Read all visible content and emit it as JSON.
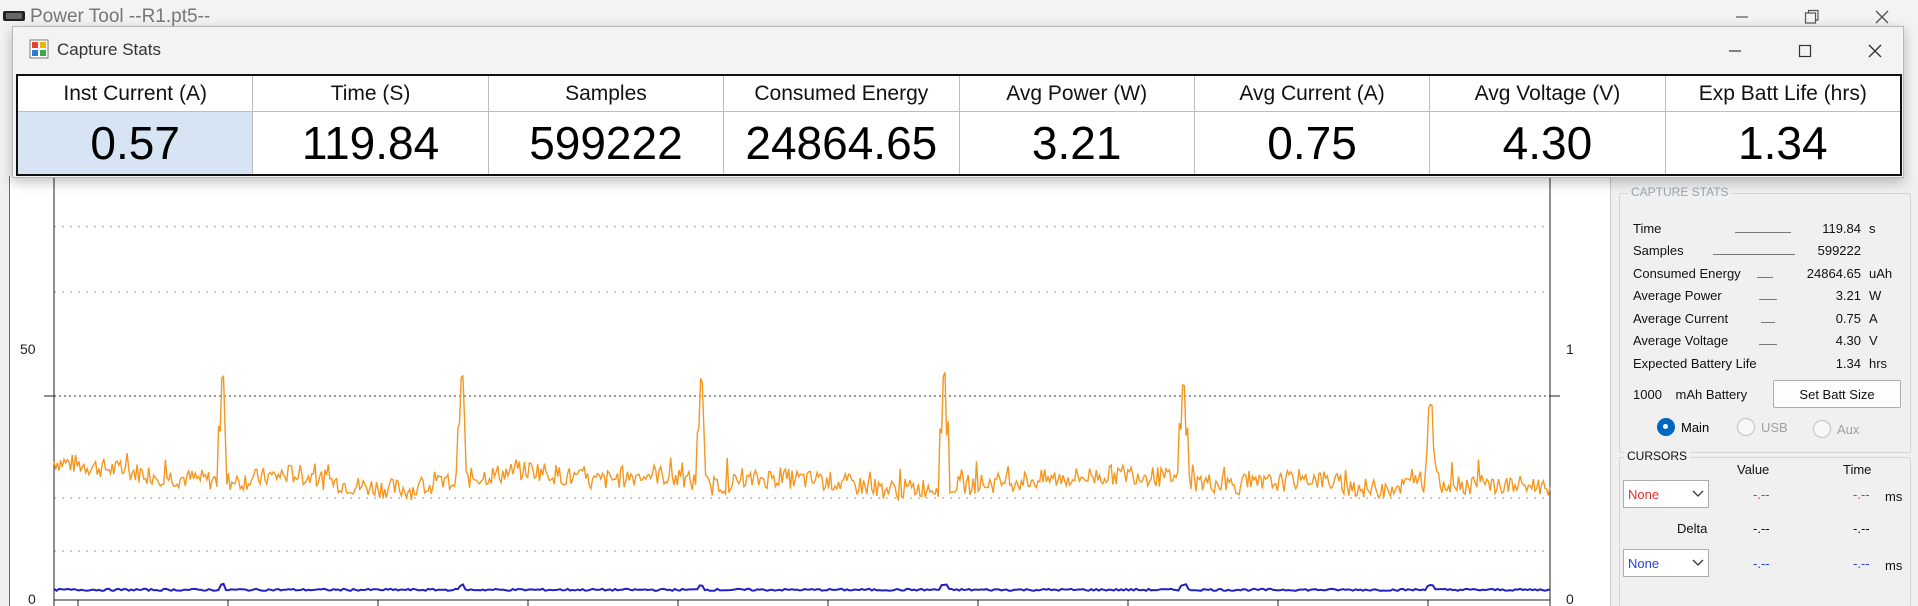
{
  "main_window": {
    "title": "Power Tool --R1.pt5--"
  },
  "capture_window": {
    "title": "Capture Stats",
    "columns": [
      {
        "header": "Inst Current (A)",
        "value": "0.57"
      },
      {
        "header": "Time (S)",
        "value": "119.84"
      },
      {
        "header": "Samples",
        "value": "599222"
      },
      {
        "header": "Consumed Energy",
        "value": "24864.65"
      },
      {
        "header": "Avg Power (W)",
        "value": "3.21"
      },
      {
        "header": "Avg Current (A)",
        "value": "0.75"
      },
      {
        "header": "Avg Voltage (V)",
        "value": "4.30"
      },
      {
        "header": "Exp Batt Life (hrs)",
        "value": "1.34"
      }
    ]
  },
  "chart_data": {
    "type": "line",
    "left_axis_ticks": [
      "50",
      "0"
    ],
    "right_axis_ticks": [
      "1",
      "0"
    ],
    "ylim": [
      0,
      100
    ],
    "series": [
      {
        "color": "#f5961e",
        "x": [
          0,
          8,
          16,
          24,
          32,
          40,
          48,
          56,
          64,
          72,
          80,
          88,
          96,
          104,
          112,
          120,
          128,
          136,
          144,
          152,
          160,
          168,
          176,
          184,
          192,
          200
        ],
        "values": [
          34,
          32,
          30,
          29,
          31,
          28,
          27,
          30,
          32,
          29,
          31,
          28,
          30,
          29,
          27,
          28,
          29,
          30,
          31,
          29,
          28,
          30,
          27,
          29,
          28,
          28
        ]
      },
      {
        "color": "#2020c8",
        "x": [
          0,
          50,
          100,
          150,
          200
        ],
        "values": [
          2.5,
          2.5,
          2.5,
          2.5,
          2.5
        ]
      }
    ],
    "orange_spikes": [
      {
        "x": 22.5,
        "y": 56
      },
      {
        "x": 54.5,
        "y": 56
      },
      {
        "x": 86.5,
        "y": 55
      },
      {
        "x": 119,
        "y": 56
      },
      {
        "x": 151,
        "y": 54
      },
      {
        "x": 184,
        "y": 48
      }
    ]
  },
  "right_panel": {
    "capture_stats": {
      "title": "CAPTURE STATS",
      "rows": [
        {
          "label": "Time",
          "value": "119.84",
          "unit": "s"
        },
        {
          "label": "Samples",
          "value": "599222",
          "unit": ""
        },
        {
          "label": "Consumed Energy",
          "value": "24864.65",
          "unit": "uAh"
        },
        {
          "label": "Average Power",
          "value": "3.21",
          "unit": "W"
        },
        {
          "label": "Average Current",
          "value": "0.75",
          "unit": "A"
        },
        {
          "label": "Average Voltage",
          "value": "4.30",
          "unit": "V"
        },
        {
          "label": "Expected Battery Life",
          "value": "1.34",
          "unit": "hrs"
        }
      ],
      "battery_size": "1000",
      "battery_label": "mAh Battery",
      "set_batt_button": "Set Batt Size",
      "channels": [
        {
          "label": "Main",
          "selected": true
        },
        {
          "label": "USB",
          "selected": false
        },
        {
          "label": "Aux",
          "selected": false
        }
      ]
    },
    "cursors": {
      "title": "CURSORS",
      "value_header": "Value",
      "time_header": "Time",
      "delta_label": "Delta",
      "cursor1": {
        "select": "None",
        "value": "-.--",
        "time": "-.--",
        "unit": "ms"
      },
      "delta": {
        "value": "-.--",
        "time": "-.--"
      },
      "cursor2": {
        "select": "None",
        "value": "-.--",
        "time": "-.--",
        "unit": "ms"
      }
    }
  },
  "colors": {
    "orange_trace": "#f5961e",
    "blue_trace": "#2020c8",
    "selected_cell": "#d6e4f3",
    "cursor1_text": "#e53030",
    "cursor2_text": "#2a3fd8"
  }
}
